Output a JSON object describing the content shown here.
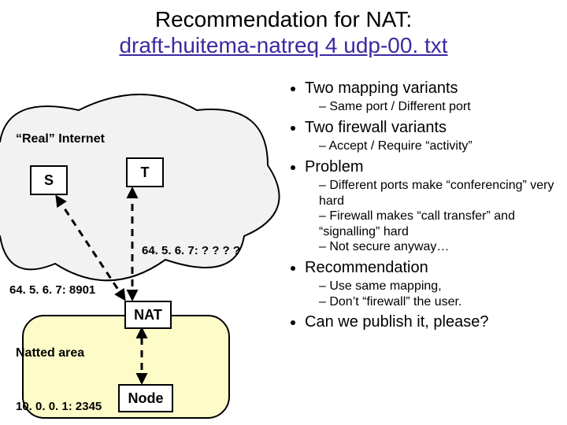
{
  "title": {
    "line1": "Recommendation for NAT:",
    "link": "draft-huitema-natreq 4 udp-00. txt"
  },
  "diagram": {
    "cloud_label": "“Real” Internet",
    "box_s": "S",
    "box_t": "T",
    "box_nat": "NAT",
    "box_node": "Node",
    "addr_t": "64. 5. 6. 7: ? ? ? ?",
    "addr_s": "64. 5. 6. 7: 8901",
    "natted_label": "Natted area",
    "addr_node": "10. 0. 0. 1: 2345"
  },
  "bullets": {
    "b1": "Two mapping variants",
    "b1a": "Same port / Different port",
    "b2": "Two firewall variants",
    "b2a": "Accept / Require “activity”",
    "b3": "Problem",
    "b3a": "Different ports make “conferencing” very hard",
    "b3b": "Firewall makes “call transfer” and “signalling” hard",
    "b3c": "Not secure anyway…",
    "b4": "Recommendation",
    "b4a": "Use same mapping,",
    "b4b": "Don’t “firewall” the user.",
    "b5": "Can we publish it, please?"
  }
}
